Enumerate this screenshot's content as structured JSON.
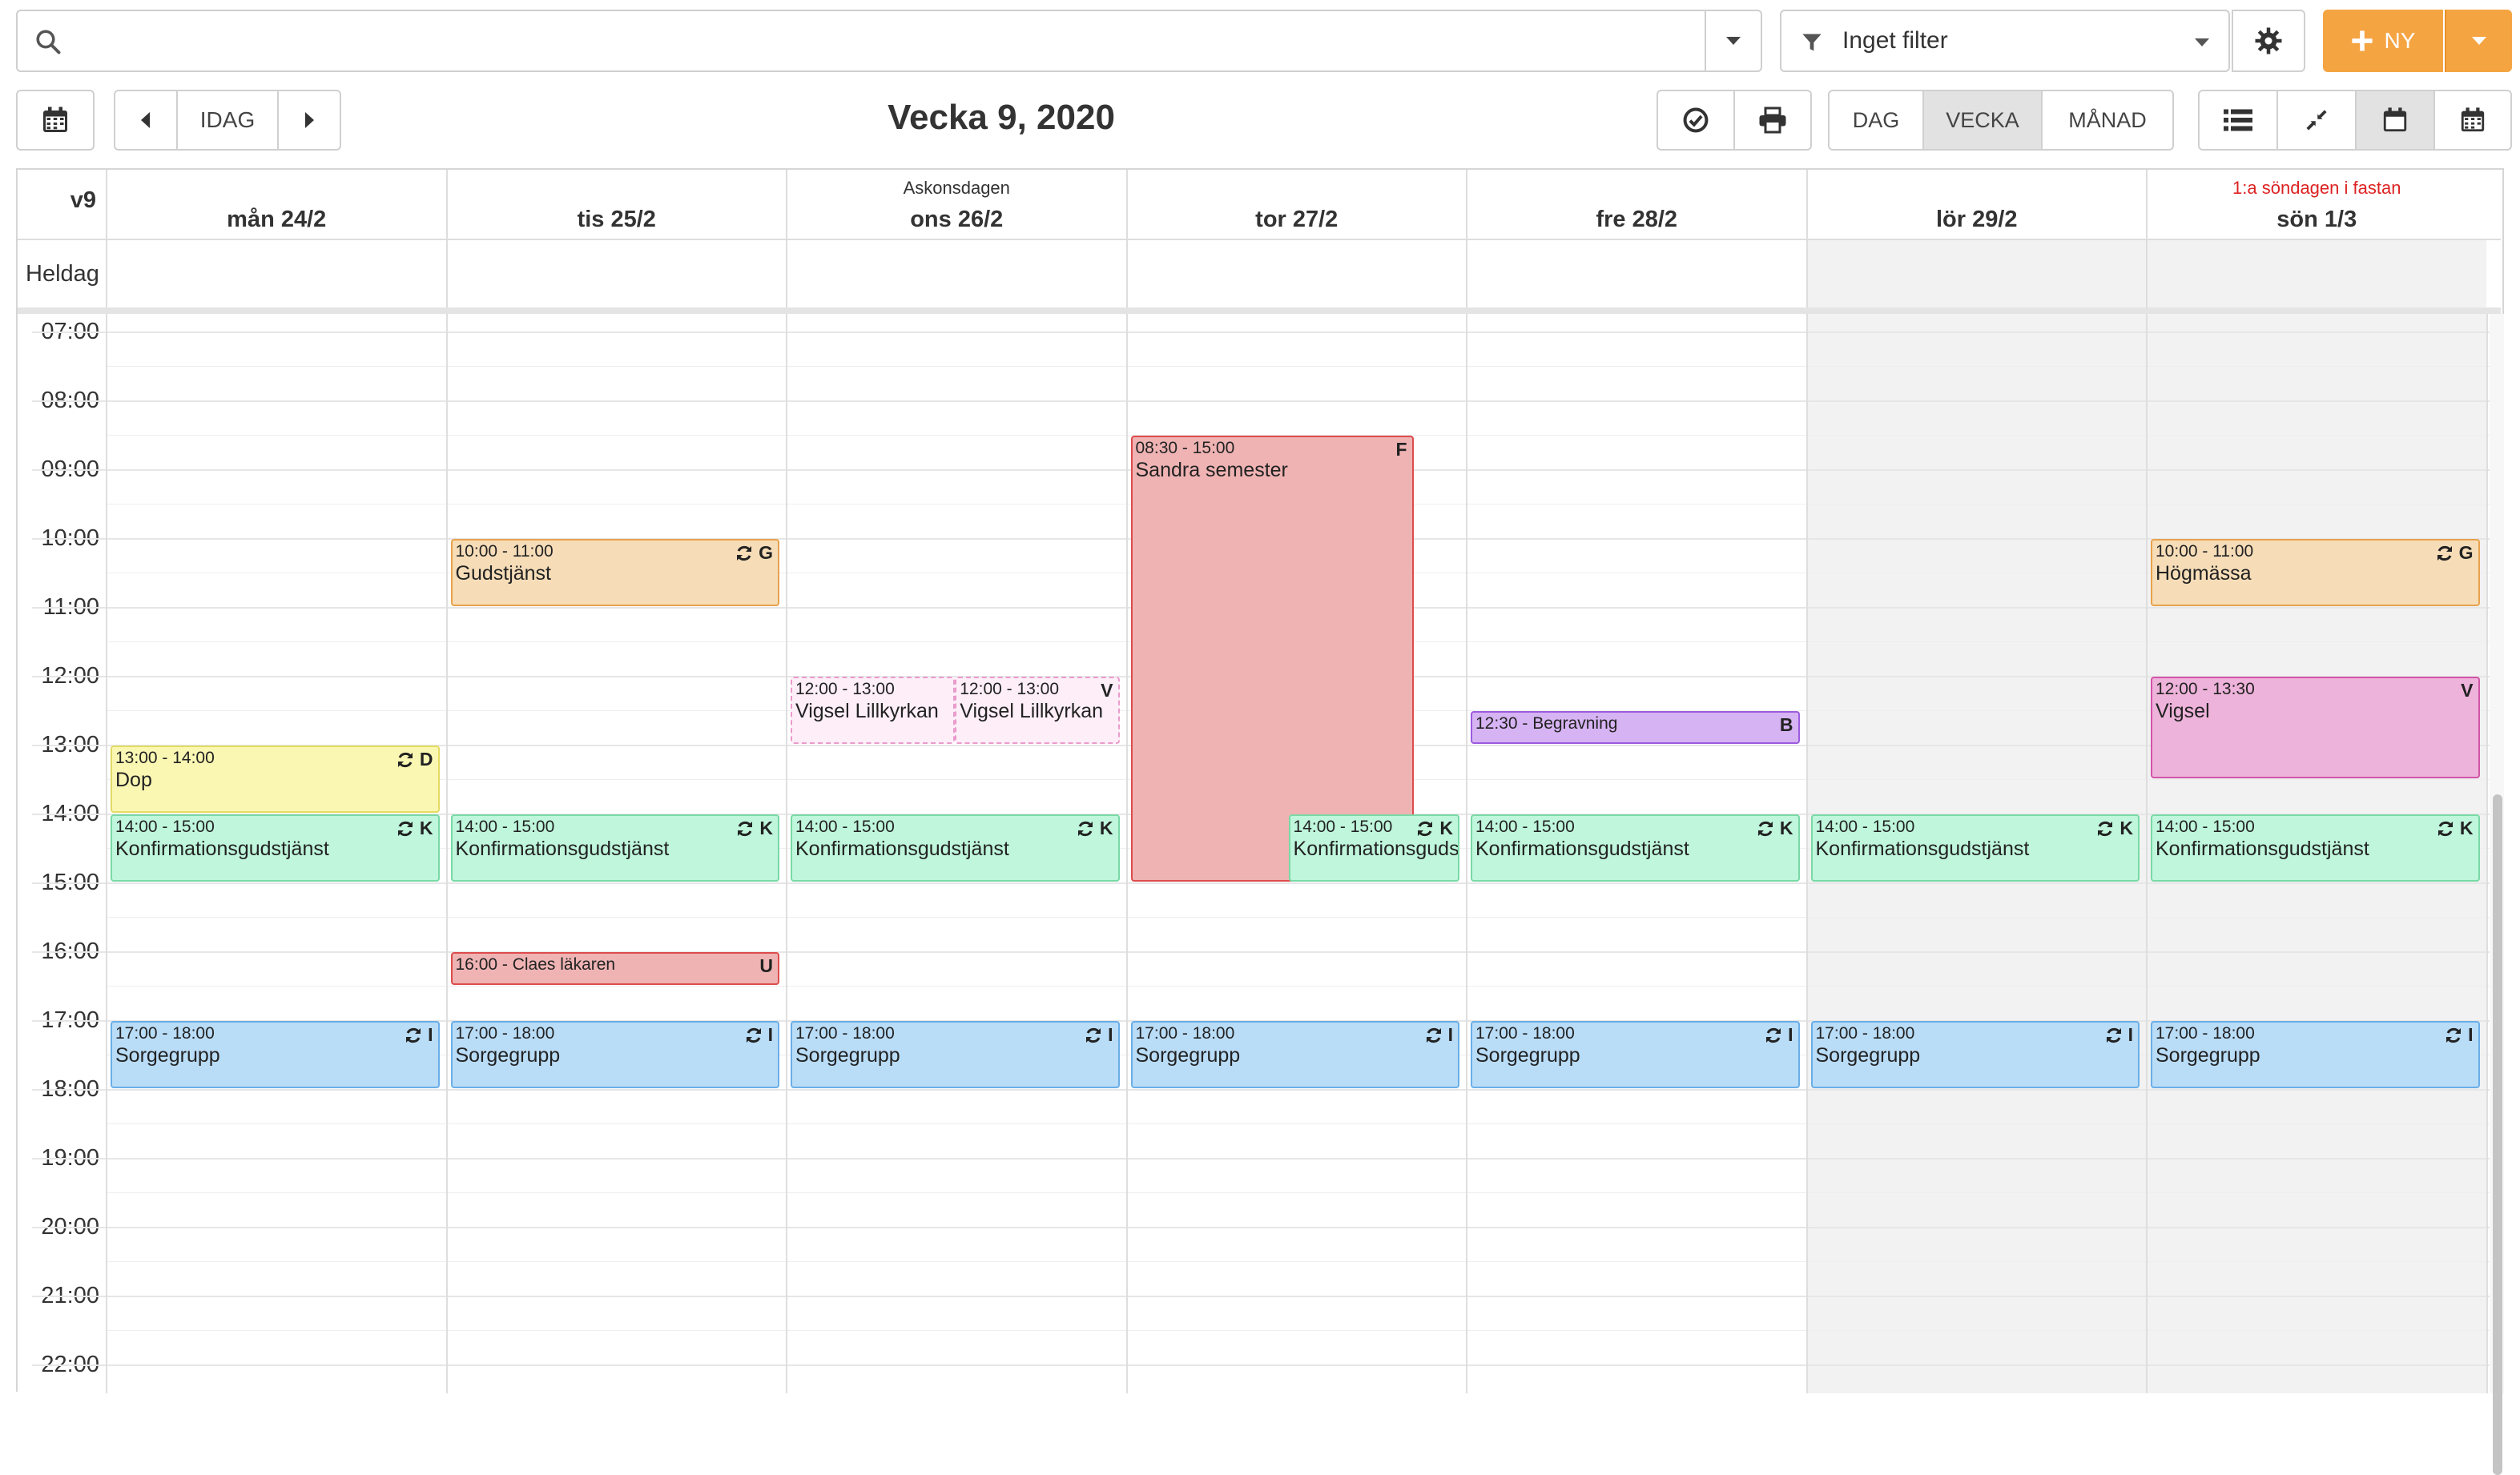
{
  "search": {
    "placeholder": ""
  },
  "filter": {
    "label": "Inget filter"
  },
  "new_button": {
    "label": "NY"
  },
  "nav": {
    "today_label": "IDAG"
  },
  "title": "Vecka 9, 2020",
  "views": {
    "day": "DAG",
    "week": "VECKA",
    "month": "MÅNAD",
    "active": "VECKA"
  },
  "calendar": {
    "week_label": "v9",
    "allday_label": "Heldag",
    "days": [
      {
        "label": "mån 24/2",
        "holiday": "",
        "weekend": false
      },
      {
        "label": "tis 25/2",
        "holiday": "",
        "weekend": false
      },
      {
        "label": "ons 26/2",
        "holiday": "Askonsdagen",
        "weekend": false
      },
      {
        "label": "tor 27/2",
        "holiday": "",
        "weekend": false
      },
      {
        "label": "fre 28/2",
        "holiday": "",
        "weekend": false
      },
      {
        "label": "lör 29/2",
        "holiday": "",
        "weekend": true
      },
      {
        "label": "sön 1/3",
        "holiday": "1:a söndagen i fastan",
        "weekend": true,
        "holiday_red": true
      }
    ],
    "hours": [
      "07:00",
      "08:00",
      "09:00",
      "10:00",
      "11:00",
      "12:00",
      "13:00",
      "14:00",
      "15:00",
      "16:00",
      "17:00",
      "18:00",
      "19:00",
      "20:00",
      "21:00",
      "22:00"
    ],
    "events": [
      {
        "day": 0,
        "start": 13,
        "end": 14,
        "time": "13:00 - 14:00",
        "title": "Dop",
        "code": "D",
        "recurring": true,
        "color": "yellow"
      },
      {
        "day": 0,
        "start": 14,
        "end": 15,
        "time": "14:00 - 15:00",
        "title": "Konfirmationsgudstjänst",
        "code": "K",
        "recurring": true,
        "color": "green"
      },
      {
        "day": 0,
        "start": 17,
        "end": 18,
        "time": "17:00 - 18:00",
        "title": "Sorgegrupp",
        "code": "I",
        "recurring": true,
        "color": "blue"
      },
      {
        "day": 1,
        "start": 10,
        "end": 11,
        "time": "10:00 - 11:00",
        "title": "Gudstjänst",
        "code": "G",
        "recurring": true,
        "color": "gold"
      },
      {
        "day": 1,
        "start": 14,
        "end": 15,
        "time": "14:00 - 15:00",
        "title": "Konfirmationsgudstjänst",
        "code": "K",
        "recurring": true,
        "color": "green"
      },
      {
        "day": 1,
        "start": 16,
        "end": 16.5,
        "time": "16:00 - Claes läkaren",
        "title": "",
        "code": "U",
        "recurring": false,
        "color": "red",
        "inline": true
      },
      {
        "day": 1,
        "start": 17,
        "end": 18,
        "time": "17:00 - 18:00",
        "title": "Sorgegrupp",
        "code": "I",
        "recurring": true,
        "color": "blue"
      },
      {
        "day": 2,
        "start": 12,
        "end": 13,
        "time": "12:00 - 13:00",
        "title": "Vigsel Lillkyrkan",
        "code": "",
        "recurring": false,
        "color": "pinklight",
        "col": 0,
        "cols": 2
      },
      {
        "day": 2,
        "start": 12,
        "end": 13,
        "time": "12:00 - 13:00",
        "title": "Vigsel Lillkyrkan",
        "code": "V",
        "recurring": false,
        "color": "pinklight",
        "col": 1,
        "cols": 2
      },
      {
        "day": 2,
        "start": 14,
        "end": 15,
        "time": "14:00 - 15:00",
        "title": "Konfirmationsgudstjänst",
        "code": "K",
        "recurring": true,
        "color": "green"
      },
      {
        "day": 2,
        "start": 17,
        "end": 18,
        "time": "17:00 - 18:00",
        "title": "Sorgegrupp",
        "code": "I",
        "recurring": true,
        "color": "blue"
      },
      {
        "day": 3,
        "start": 8.5,
        "end": 15,
        "time": "08:30 - 15:00",
        "title": "Sandra semester",
        "code": "F",
        "recurring": false,
        "color": "red",
        "width": 0.86
      },
      {
        "day": 3,
        "start": 14,
        "end": 15,
        "time": "14:00 - 15:00",
        "title": "Konfirmationsgudstjänst",
        "code": "K",
        "recurring": true,
        "color": "green",
        "offset": 0.48
      },
      {
        "day": 3,
        "start": 17,
        "end": 18,
        "time": "17:00 - 18:00",
        "title": "Sorgegrupp",
        "code": "I",
        "recurring": true,
        "color": "blue"
      },
      {
        "day": 4,
        "start": 12.5,
        "end": 13,
        "time": "12:30 - Begravning",
        "title": "",
        "code": "B",
        "recurring": false,
        "color": "purple",
        "inline": true
      },
      {
        "day": 4,
        "start": 14,
        "end": 15,
        "time": "14:00 - 15:00",
        "title": "Konfirmationsgudstjänst",
        "code": "K",
        "recurring": true,
        "color": "green"
      },
      {
        "day": 4,
        "start": 17,
        "end": 18,
        "time": "17:00 - 18:00",
        "title": "Sorgegrupp",
        "code": "I",
        "recurring": true,
        "color": "blue"
      },
      {
        "day": 5,
        "start": 14,
        "end": 15,
        "time": "14:00 - 15:00",
        "title": "Konfirmationsgudstjänst",
        "code": "K",
        "recurring": true,
        "color": "green"
      },
      {
        "day": 5,
        "start": 17,
        "end": 18,
        "time": "17:00 - 18:00",
        "title": "Sorgegrupp",
        "code": "I",
        "recurring": true,
        "color": "blue"
      },
      {
        "day": 6,
        "start": 10,
        "end": 11,
        "time": "10:00 - 11:00",
        "title": "Högmässa",
        "code": "G",
        "recurring": true,
        "color": "gold"
      },
      {
        "day": 6,
        "start": 12,
        "end": 13.5,
        "time": "12:00 - 13:30",
        "title": "Vigsel",
        "code": "V",
        "recurring": false,
        "color": "pink"
      },
      {
        "day": 6,
        "start": 14,
        "end": 15,
        "time": "14:00 - 15:00",
        "title": "Konfirmationsgudstjänst",
        "code": "K",
        "recurring": true,
        "color": "green"
      },
      {
        "day": 6,
        "start": 17,
        "end": 18,
        "time": "17:00 - 18:00",
        "title": "Sorgegrupp",
        "code": "I",
        "recurring": true,
        "color": "blue"
      }
    ]
  },
  "colors": {
    "accent": "#f5a442",
    "accent_dark": "#e8912a",
    "weekend_bg": "#f2f2f2",
    "holiday_red": "#d22222"
  },
  "icons": [
    "search-icon",
    "caret-down-icon",
    "filter-icon",
    "gear-icon",
    "plus-icon",
    "calendar-icon",
    "chevron-left-icon",
    "chevron-right-icon",
    "check-circle-icon",
    "print-icon",
    "list-icon",
    "compress-icon",
    "calendar-day-icon",
    "calendar-grid-icon",
    "recurring-icon"
  ]
}
